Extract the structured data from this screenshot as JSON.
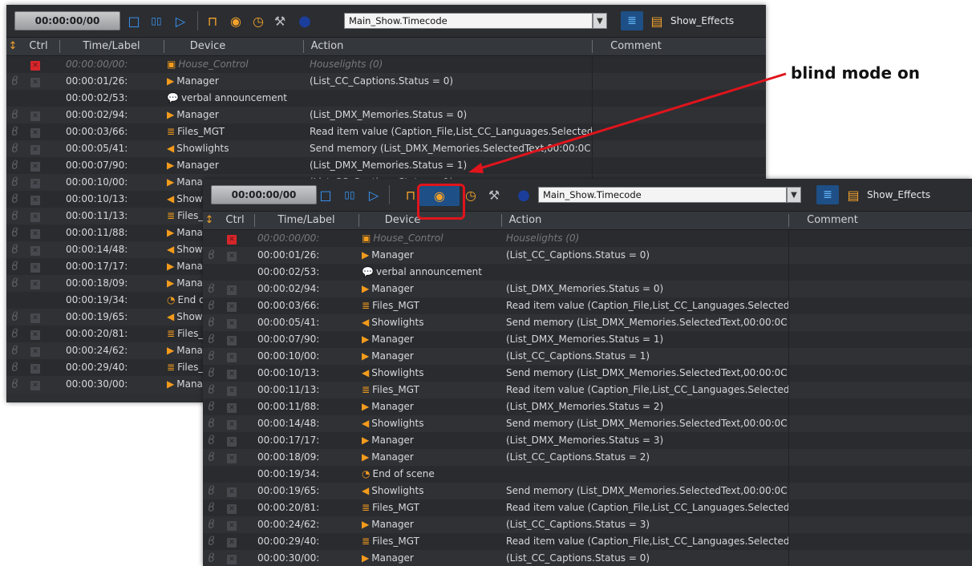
{
  "annotation": {
    "label": "blind mode on",
    "color": "#e0141c"
  },
  "toolbar": {
    "timecode": "00:00:00/00",
    "dropdown_value": "Main_Show.Timecode",
    "effects_label": "Show_Effects",
    "icons": [
      "stop-icon",
      "pause-icon",
      "play-icon",
      "lock-icon",
      "eye-icon",
      "clock-history-icon",
      "wrench-icon",
      "sphere-icon",
      "dropdown-arrow-icon",
      "list-icon",
      "effects-icon"
    ]
  },
  "columns": {
    "ctrl": "Ctrl",
    "time": "Time/Label",
    "device": "Device",
    "action": "Action",
    "comment": "Comment"
  },
  "rows": [
    {
      "time": "00:00:00/00:",
      "device": "House_Control",
      "device_icon": "▣",
      "action": "Houselights (0)",
      "dim": true,
      "x": "red",
      "flag": false
    },
    {
      "time": "00:00:01/26:",
      "device": "Manager",
      "device_icon": "▶",
      "action": "(List_CC_Captions.Status = 0)",
      "x": "gray",
      "flag": true
    },
    {
      "time": "00:00:02/53:",
      "device": "verbal announcement",
      "device_icon": "💬",
      "action": "",
      "x": "",
      "flag": false
    },
    {
      "time": "00:00:02/94:",
      "device": "Manager",
      "device_icon": "▶",
      "action": "(List_DMX_Memories.Status = 0)",
      "x": "gray",
      "flag": true
    },
    {
      "time": "00:00:03/66:",
      "device": "Files_MGT",
      "device_icon": "≣",
      "action": "Read item value (Caption_File,List_CC_Languages.Selected",
      "x": "gray",
      "flag": true
    },
    {
      "time": "00:00:05/41:",
      "device": "Showlights",
      "device_icon": "◀",
      "action": "Send memory (List_DMX_Memories.SelectedText,00:00:0C",
      "x": "gray",
      "flag": true
    },
    {
      "time": "00:00:07/90:",
      "device": "Manager",
      "device_icon": "▶",
      "action": "(List_DMX_Memories.Status = 1)",
      "x": "gray",
      "flag": true
    },
    {
      "time": "00:00:10/00:",
      "device": "Manager",
      "device_icon": "▶",
      "action": "(List_CC_Captions.Status = 1)",
      "x": "gray",
      "flag": true
    },
    {
      "time": "00:00:10/13:",
      "device": "Showlights",
      "device_icon": "◀",
      "action": "Send memory (List_DMX_Memories.SelectedText,00:00:0C",
      "x": "gray",
      "flag": true
    },
    {
      "time": "00:00:11/13:",
      "device": "Files_MGT",
      "device_icon": "≣",
      "action": "Read item value (Caption_File,List_CC_Languages.Selected",
      "x": "gray",
      "flag": true
    },
    {
      "time": "00:00:11/88:",
      "device": "Manager",
      "device_icon": "▶",
      "action": "(List_DMX_Memories.Status = 2)",
      "x": "gray",
      "flag": true
    },
    {
      "time": "00:00:14/48:",
      "device": "Showlights",
      "device_icon": "◀",
      "action": "Send memory (List_DMX_Memories.SelectedText,00:00:0C",
      "x": "gray",
      "flag": true
    },
    {
      "time": "00:00:17/17:",
      "device": "Manager",
      "device_icon": "▶",
      "action": "(List_DMX_Memories.Status = 3)",
      "x": "gray",
      "flag": true
    },
    {
      "time": "00:00:18/09:",
      "device": "Manager",
      "device_icon": "▶",
      "action": "(List_CC_Captions.Status = 2)",
      "x": "gray",
      "flag": true
    },
    {
      "time": "00:00:19/34:",
      "device": "End of scene",
      "device_icon": "◔",
      "action": "",
      "x": "",
      "flag": false
    },
    {
      "time": "00:00:19/65:",
      "device": "Showlights",
      "device_icon": "◀",
      "action": "Send memory (List_DMX_Memories.SelectedText,00:00:0C",
      "x": "gray",
      "flag": true
    },
    {
      "time": "00:00:20/81:",
      "device": "Files_MGT",
      "device_icon": "≣",
      "action": "Read item value (Caption_File,List_CC_Languages.Selected",
      "x": "gray",
      "flag": true
    },
    {
      "time": "00:00:24/62:",
      "device": "Manager",
      "device_icon": "▶",
      "action": "(List_CC_Captions.Status = 3)",
      "x": "gray",
      "flag": true
    },
    {
      "time": "00:00:29/40:",
      "device": "Files_MGT",
      "device_icon": "≣",
      "action": "Read item value (Caption_File,List_CC_Languages.Selected",
      "x": "gray",
      "flag": true
    },
    {
      "time": "00:00:30/00:",
      "device": "Manager",
      "device_icon": "▶",
      "action": "(List_CC_Captions.Status = 0)",
      "x": "gray",
      "flag": true
    }
  ]
}
